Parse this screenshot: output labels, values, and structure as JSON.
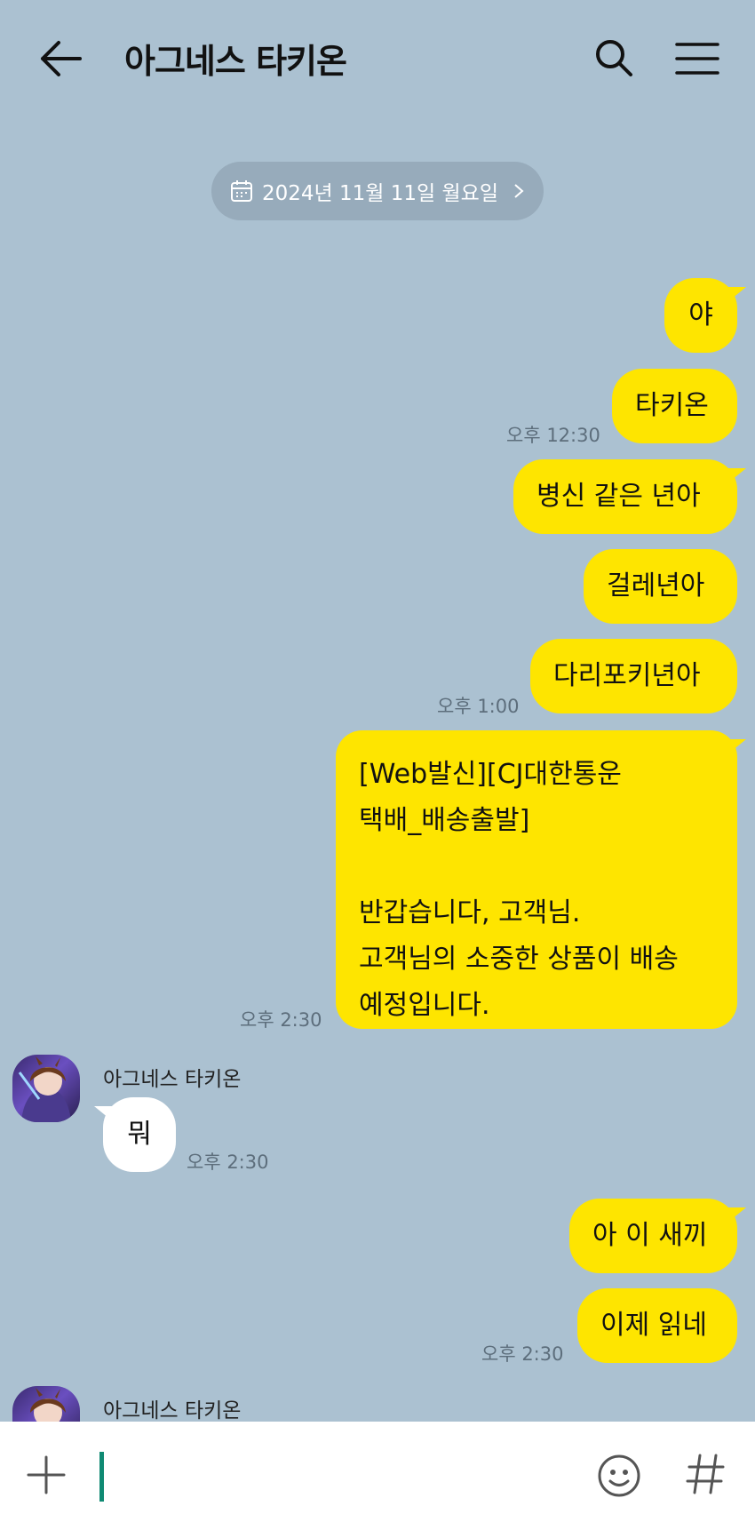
{
  "header": {
    "title": "아그네스 타키온"
  },
  "date_divider": {
    "label": "2024년 11월 11일 월요일"
  },
  "messages": {
    "m1": "야",
    "m2": "타키온",
    "t1": "오후 12:30",
    "m3": "병신 같은 년아",
    "m4": "걸레년아",
    "m5": "다리포키년아",
    "t2": "오후 1:00",
    "m6_line1": "[Web발신][CJ대한통운",
    "m6_line2": "택배_배송출발]",
    "m6_line3": "반갑습니다, 고객님.",
    "m6_line4": "고객님의 소중한 상품이 배송",
    "m6_line5": "예정입니다.",
    "t3": "오후 2:30",
    "sender1": "아그네스 타키온",
    "r1": "뭐",
    "t4": "오후 2:30",
    "m7": "아 이 새끼",
    "m8": "이제 읽네",
    "t5": "오후 2:30",
    "sender2": "아그네스 타키온"
  },
  "colors": {
    "background": "#abc1d1",
    "my_bubble": "#fee500",
    "their_bubble": "#ffffff",
    "caret": "#0f8a73"
  },
  "icons": [
    "back-arrow-icon",
    "search-icon",
    "menu-icon",
    "calendar-icon",
    "chevron-right-icon",
    "plus-icon",
    "emoji-icon",
    "hash-icon"
  ]
}
